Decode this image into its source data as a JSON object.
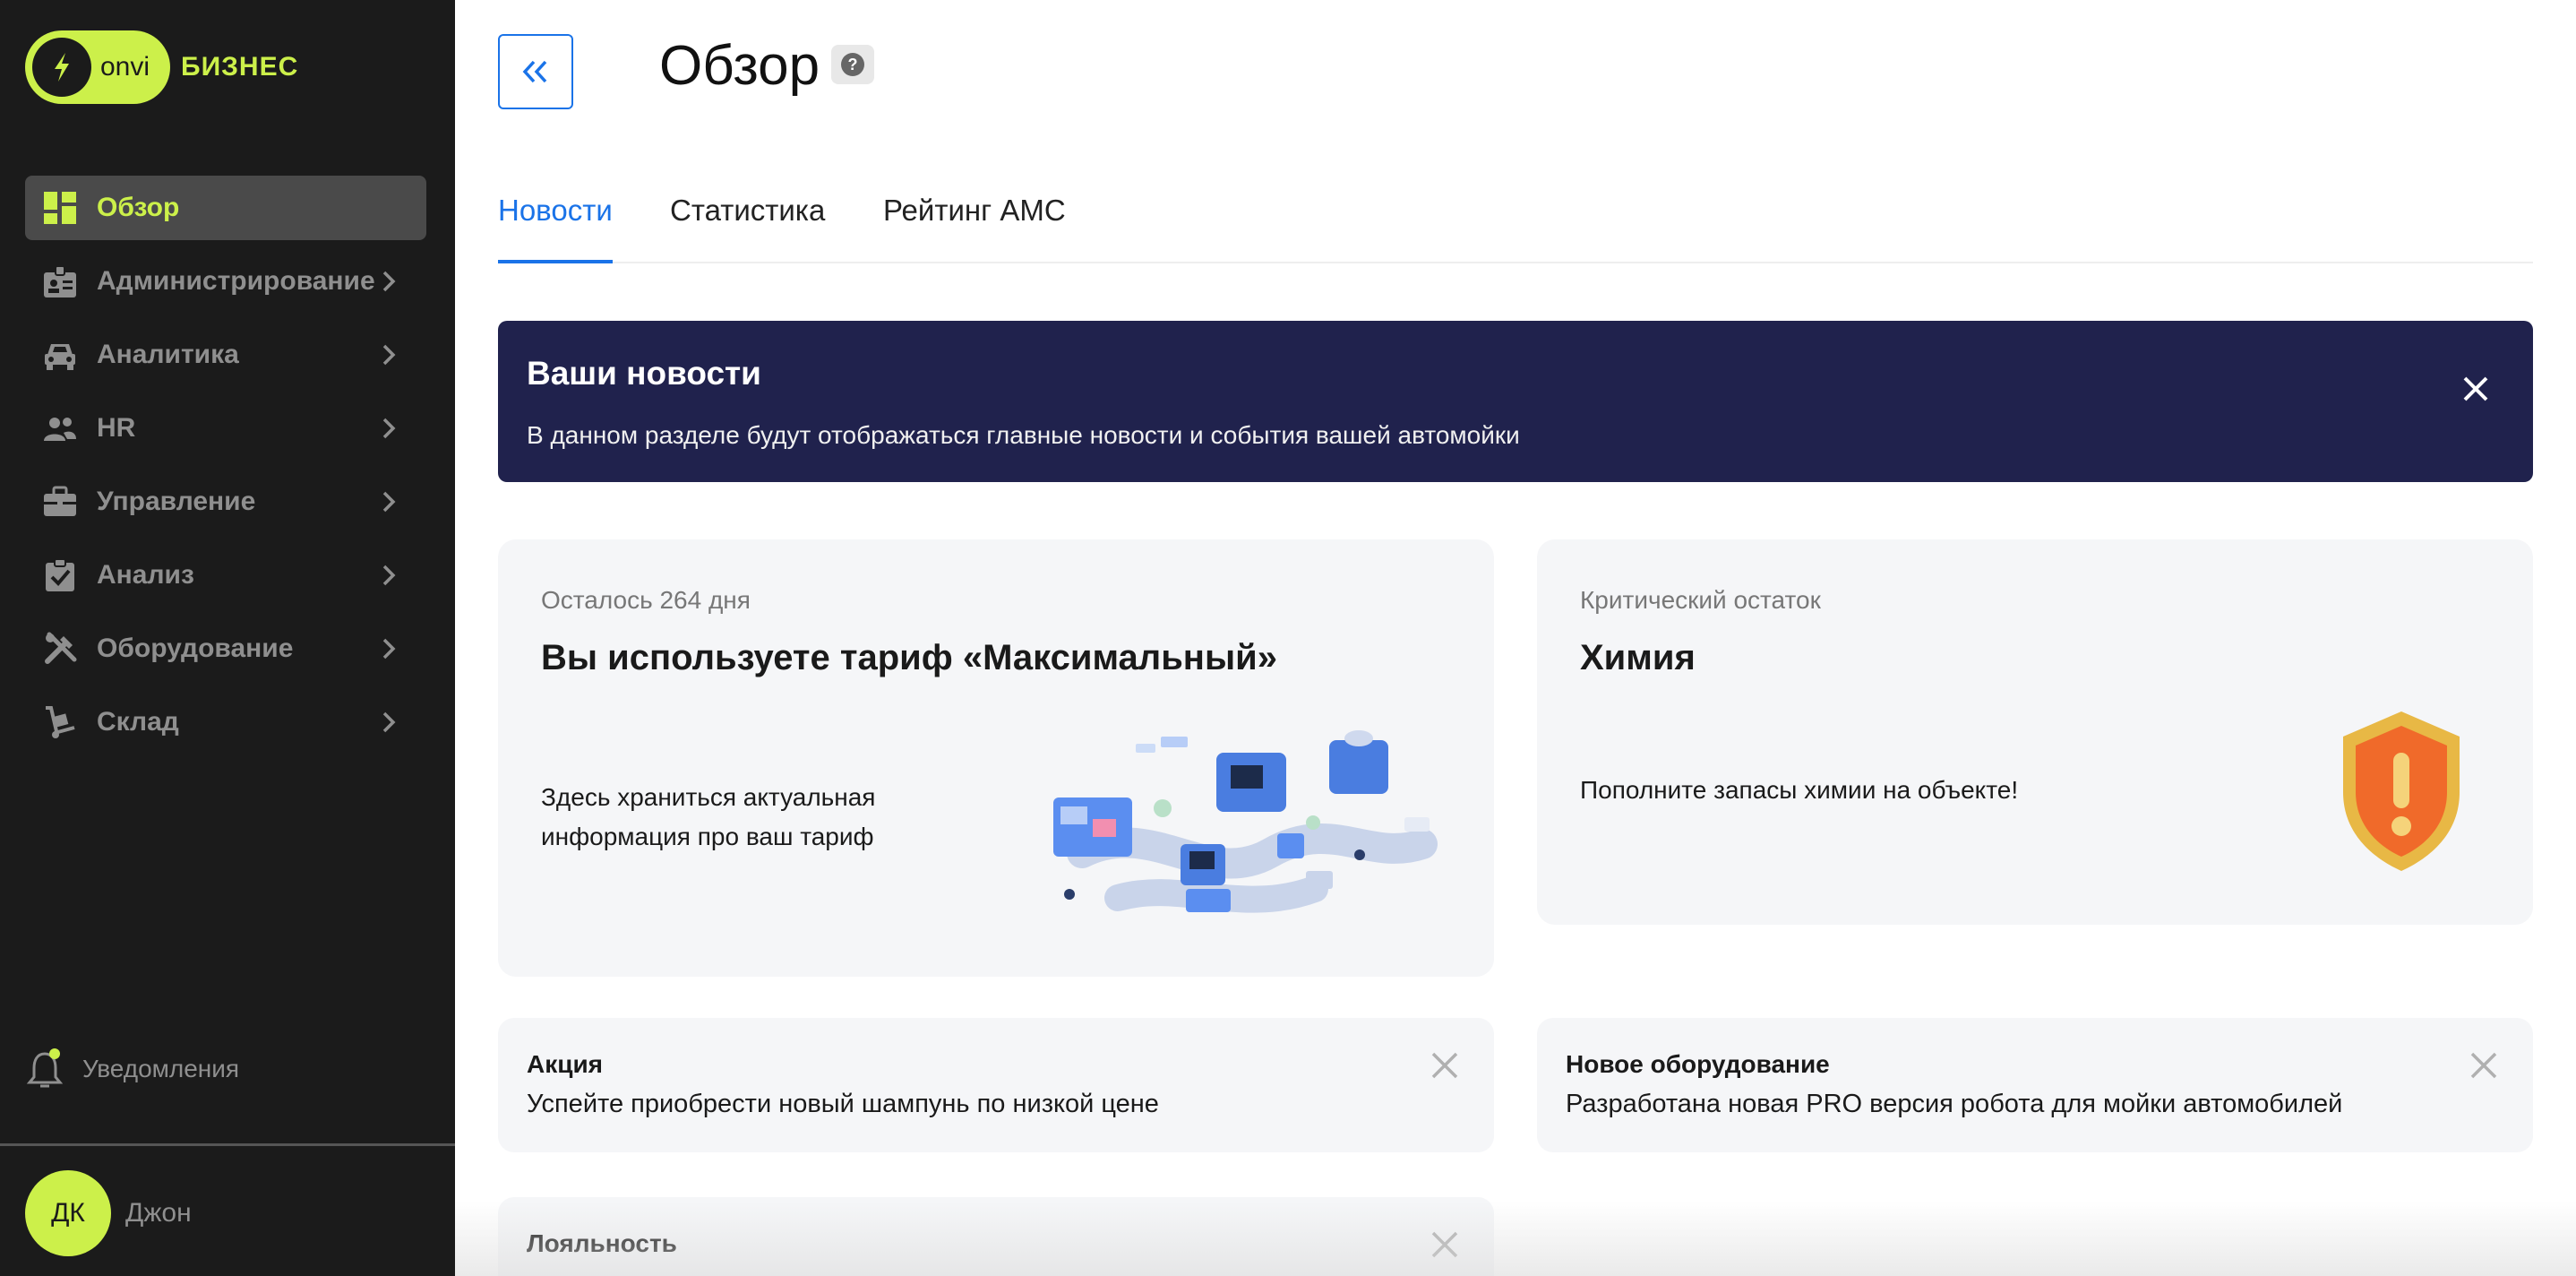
{
  "sidebar": {
    "logo_word": "onvi",
    "logo_biz": "БИЗНЕС",
    "items": [
      {
        "label": "Обзор",
        "icon": "dashboard-icon",
        "active": true
      },
      {
        "label": "Администрирование",
        "icon": "badge-icon"
      },
      {
        "label": "Аналитика",
        "icon": "car-icon"
      },
      {
        "label": "HR",
        "icon": "people-icon"
      },
      {
        "label": "Управление",
        "icon": "briefcase-icon"
      },
      {
        "label": "Анализ",
        "icon": "clipboard-check-icon"
      },
      {
        "label": "Оборудование",
        "icon": "tools-icon"
      },
      {
        "label": "Склад",
        "icon": "hand-truck-icon"
      }
    ],
    "notifications_label": "Уведомления",
    "user": {
      "initials": "ДК",
      "name": "Джон"
    }
  },
  "header": {
    "title": "Обзор",
    "help": "?"
  },
  "tabs": [
    {
      "label": "Новости",
      "active": true
    },
    {
      "label": "Статистика"
    },
    {
      "label": "Рейтинг АМС"
    }
  ],
  "banner": {
    "title": "Ваши новости",
    "text": "В данном разделе будут отображаться главные новости и события вашей автомойки"
  },
  "tariff_card": {
    "subtitle": "Осталось 264 дня",
    "title": "Вы используете тариф «Максимальный»",
    "desc_line1": "Здесь храниться актуальная",
    "desc_line2": "информация про ваш тариф"
  },
  "chem_card": {
    "subtitle": "Критический остаток",
    "title": "Химия",
    "desc": "Пополните запасы химии на объекте!"
  },
  "news": [
    {
      "title": "Акция",
      "text": "Успейте приобрести новый шампунь по низкой цене"
    },
    {
      "title": "Новое оборудование",
      "text": "Разработана новая PRO версия робота для мойки автомобилей"
    },
    {
      "title": "Лояльность",
      "text": ""
    }
  ],
  "colors": {
    "accent_lime": "#ccf04a",
    "sidebar_bg": "#1b1b1b",
    "link_blue": "#1a73e8",
    "banner_navy": "#20224d"
  }
}
